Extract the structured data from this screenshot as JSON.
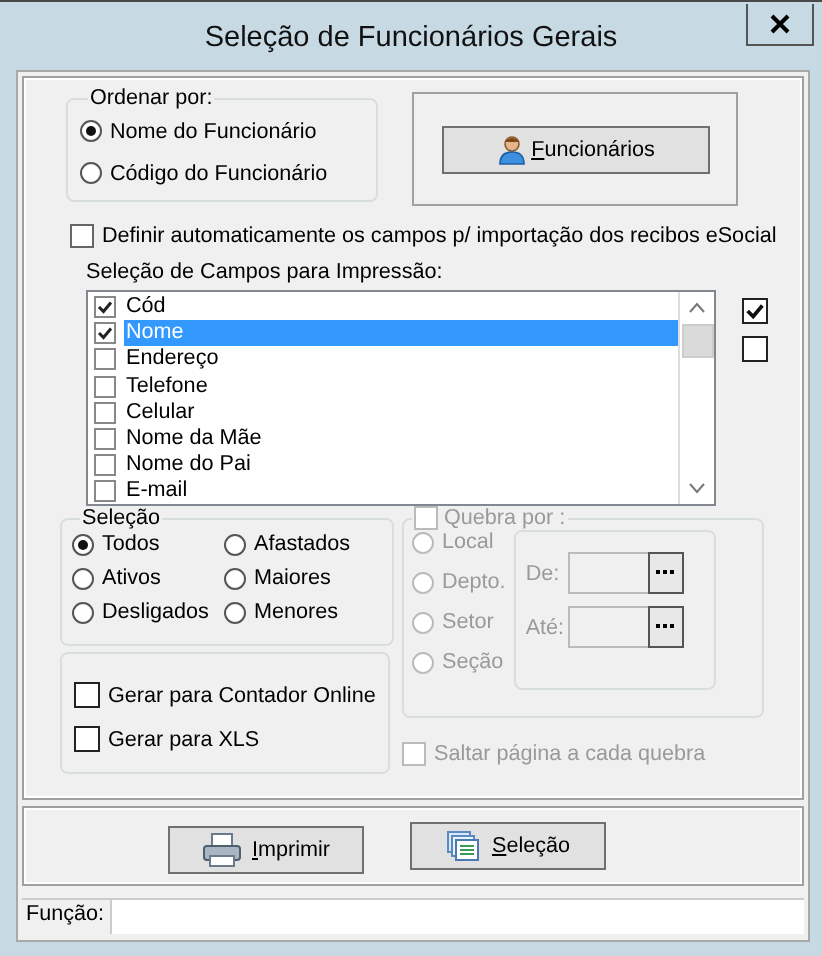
{
  "window": {
    "title": "Seleção de Funcionários Gerais"
  },
  "sort": {
    "label": "Ordenar por:",
    "options": [
      {
        "label": "Nome do Funcionário",
        "selected": true
      },
      {
        "label": "Código do Funcionário",
        "selected": false
      }
    ]
  },
  "employees_button": {
    "label": "Funcionários"
  },
  "auto_esocial": {
    "label": "Definir automaticamente os campos p/ importação dos recibos eSocial",
    "checked": false
  },
  "fields": {
    "label": "Seleção de Campos para Impressão:",
    "items": [
      {
        "label": "Cód",
        "checked": true,
        "selected": false
      },
      {
        "label": "Nome",
        "checked": true,
        "selected": true
      },
      {
        "label": "Endereço",
        "checked": false,
        "selected": false
      },
      {
        "label": "Telefone",
        "checked": false,
        "selected": false
      },
      {
        "label": "Celular",
        "checked": false,
        "selected": false
      },
      {
        "label": "Nome da Mãe",
        "checked": false,
        "selected": false
      },
      {
        "label": "Nome do Pai",
        "checked": false,
        "selected": false
      },
      {
        "label": "E-mail",
        "checked": false,
        "selected": false
      }
    ]
  },
  "side_checks": [
    {
      "checked": true
    },
    {
      "checked": false
    }
  ],
  "selection": {
    "label": "Seleção",
    "options": [
      {
        "label": "Todos",
        "selected": true
      },
      {
        "label": "Afastados",
        "selected": false
      },
      {
        "label": "Ativos",
        "selected": false
      },
      {
        "label": "Maiores",
        "selected": false
      },
      {
        "label": "Desligados",
        "selected": false
      },
      {
        "label": "Menores",
        "selected": false
      }
    ]
  },
  "exports": [
    {
      "label": "Gerar para Contador Online",
      "checked": false
    },
    {
      "label": "Gerar para XLS",
      "checked": false
    }
  ],
  "break": {
    "label": "Quebra por :",
    "checked": false,
    "disabled": true,
    "options": [
      {
        "label": "Local",
        "selected": false
      },
      {
        "label": "Depto.",
        "selected": false
      },
      {
        "label": "Setor",
        "selected": false
      },
      {
        "label": "Seção",
        "selected": false
      }
    ],
    "from": {
      "label": "De:"
    },
    "to": {
      "label": "Até:"
    }
  },
  "skip_page": {
    "label": "Saltar página a cada quebra",
    "checked": false,
    "disabled": true
  },
  "buttons": [
    {
      "label": "Imprimir",
      "kind": "print"
    },
    {
      "label": "Seleção",
      "kind": "selection"
    }
  ],
  "status": {
    "label": "Função:"
  }
}
